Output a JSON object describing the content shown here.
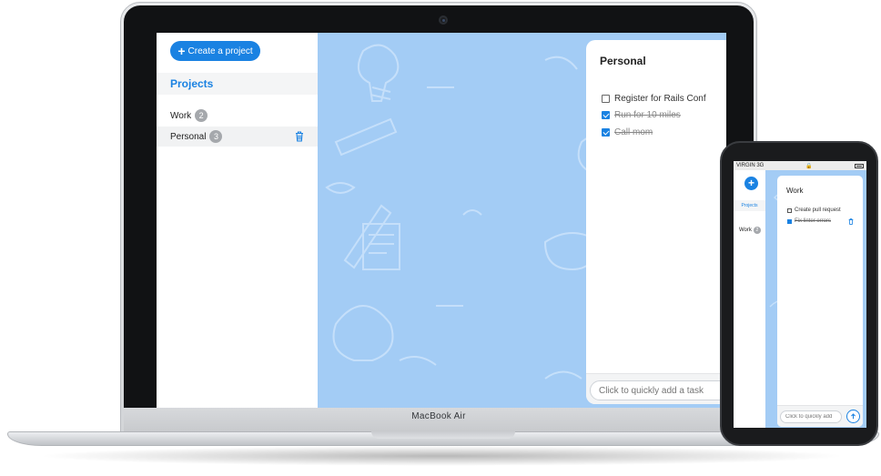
{
  "laptop": {
    "brand_label": "MacBook Air",
    "sidebar": {
      "create_button_label": "Create a project",
      "projects_heading": "Projects",
      "projects": [
        {
          "name": "Work",
          "count": "2"
        },
        {
          "name": "Personal",
          "count": "3"
        }
      ]
    },
    "card": {
      "title": "Personal",
      "tasks": [
        {
          "text": "Register for Rails Conf",
          "done": false
        },
        {
          "text": "Run for 10 miles",
          "done": true
        },
        {
          "text": "Call mom",
          "done": true
        }
      ],
      "quick_add_placeholder": "Click to quickly add a task"
    }
  },
  "phone": {
    "status": {
      "carrier": "VIRGIN 3G"
    },
    "sidebar": {
      "projects_heading": "Projects",
      "projects": [
        {
          "name": "Work",
          "count": "2"
        }
      ]
    },
    "card": {
      "title": "Work",
      "tasks": [
        {
          "text": "Create pull request",
          "done": false
        },
        {
          "text": "Fix linter errors",
          "done": true
        }
      ],
      "quick_add_placeholder": "Click to quickly add"
    }
  },
  "colors": {
    "accent": "#1a82e2",
    "pattern_background": "#a3ccf5",
    "badge": "#a5a8ac"
  },
  "icons": [
    "plus-icon",
    "trash-icon",
    "arrow-up-icon",
    "camera",
    "battery-icon",
    "lock-icon"
  ]
}
